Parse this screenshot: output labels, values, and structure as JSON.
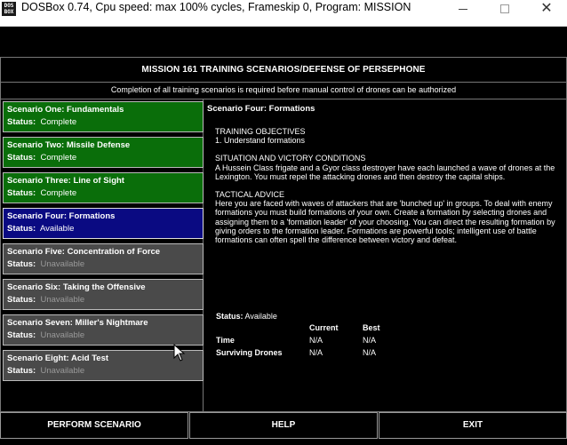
{
  "window": {
    "title": "DOSBox 0.74, Cpu speed: max 100% cycles, Frameskip  0, Program:  MISSION",
    "icon_text": "DOS BOX",
    "controls": [
      "minimize",
      "maximize",
      "close"
    ]
  },
  "header": {
    "title": "MISSION 161 TRAINING SCENARIOS/DEFENSE OF PERSEPHONE",
    "subtitle": "Completion of all training scenarios is required before manual control of drones can be authorized"
  },
  "scenarios": [
    {
      "name": "Scenario One: Fundamentals",
      "status_label": "Status:",
      "status": "Complete"
    },
    {
      "name": "Scenario Two: Missile Defense",
      "status_label": "Status:",
      "status": "Complete"
    },
    {
      "name": "Scenario Three: Line of Sight",
      "status_label": "Status:",
      "status": "Complete"
    },
    {
      "name": "Scenario Four: Formations",
      "status_label": "Status:",
      "status": "Available"
    },
    {
      "name": "Scenario Five: Concentration of Force",
      "status_label": "Status:",
      "status": "Unavailable"
    },
    {
      "name": "Scenario Six: Taking the Offensive",
      "status_label": "Status:",
      "status": "Unavailable"
    },
    {
      "name": "Scenario Seven: Miller's Nightmare",
      "status_label": "Status:",
      "status": "Unavailable"
    },
    {
      "name": "Scenario Eight: Acid Test",
      "status_label": "Status:",
      "status": "Unavailable"
    }
  ],
  "detail": {
    "title": "Scenario Four: Formations",
    "objectives_heading": "TRAINING OBJECTIVES",
    "objectives_text": "1. Understand formations",
    "victory_heading": "SITUATION AND VICTORY CONDITIONS",
    "victory_text": "A Hussein Class frigate and a Gyor class destroyer have each launched a wave of drones at the Lexington. You must repel the attacking drones and then destroy the capital ships.",
    "advice_heading": "TACTICAL ADVICE",
    "advice_text": "Here you are faced with waves of attackers that are 'bunched up' in groups. To deal with enemy formations you must build formations of your own. Create a formation by selecting drones and assigning them to a 'formation leader' of your choosing. You can direct the resulting formation by giving orders to the formation leader. Formations are powerful tools; intelligent use of battle formations can often spell the difference between victory and defeat.",
    "status_label": "Status:",
    "status_value": "Available",
    "stats": {
      "col_current": "Current",
      "col_best": "Best",
      "rows": [
        {
          "label": "Time",
          "current": "N/A",
          "best": "N/A"
        },
        {
          "label": "Surviving Drones",
          "current": "N/A",
          "best": "N/A"
        }
      ]
    }
  },
  "buttons": {
    "perform": "PERFORM SCENARIO",
    "help": "HELP",
    "exit": "EXIT"
  },
  "colors": {
    "complete": "#0a6e0a",
    "available": "#0a0a82",
    "unavailable": "#4a4a4a",
    "background": "#000000"
  }
}
